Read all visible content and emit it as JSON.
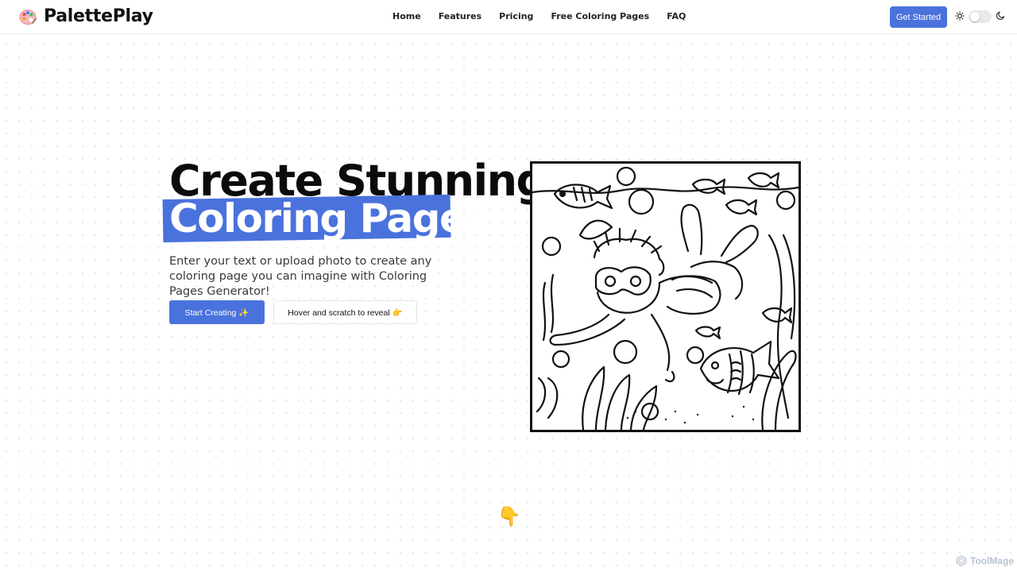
{
  "header": {
    "brand": "PalettePlay",
    "nav": [
      "Home",
      "Features",
      "Pricing",
      "Free Coloring Pages",
      "FAQ"
    ],
    "cta": "Get Started",
    "theme_toggle": "off"
  },
  "hero": {
    "title_line1": "Create Stunning",
    "title_line2": "Coloring Pages",
    "description": "Enter your text or upload photo to create any coloring page you can imagine with Coloring Pages Generator!",
    "primary_button": "Start Creating ✨",
    "secondary_button": "Hover and scratch to reveal 👉",
    "scroll_hint": "👇"
  },
  "watermark": "ToolMage",
  "colors": {
    "accent": "#4a72dc",
    "text": "#0b0b0b",
    "watermark": "#b8c3d3"
  }
}
